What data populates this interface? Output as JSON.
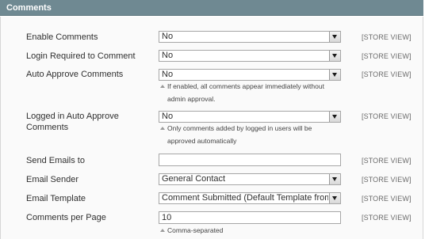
{
  "section": {
    "title": "Comments"
  },
  "fields": [
    {
      "label": "Enable Comments",
      "value": "No",
      "scope": "[STORE VIEW]"
    },
    {
      "label": "Login Required to Comment",
      "value": "No",
      "scope": "[STORE VIEW]"
    },
    {
      "label": "Auto Approve Comments",
      "value": "No",
      "scope": "[STORE VIEW]",
      "note": "If enabled, all comments appear immediately without",
      "note2": "admin approval."
    },
    {
      "label": "Logged in Auto Approve",
      "label2": "Comments",
      "value": "No",
      "scope": "[STORE VIEW]",
      "note": "Only comments added by logged in users will be",
      "note2": "approved automatically"
    },
    {
      "label": "Send Emails to",
      "value": "",
      "scope": "[STORE VIEW]"
    },
    {
      "label": "Email Sender",
      "value": "General Contact",
      "scope": "[STORE VIEW]"
    },
    {
      "label": "Email Template",
      "value": "Comment Submitted (Default Template from Lo",
      "scope": "[STORE VIEW]"
    },
    {
      "label": "Comments per Page",
      "value": "10",
      "scope": "[STORE VIEW]",
      "note": "Comma-separated"
    }
  ]
}
